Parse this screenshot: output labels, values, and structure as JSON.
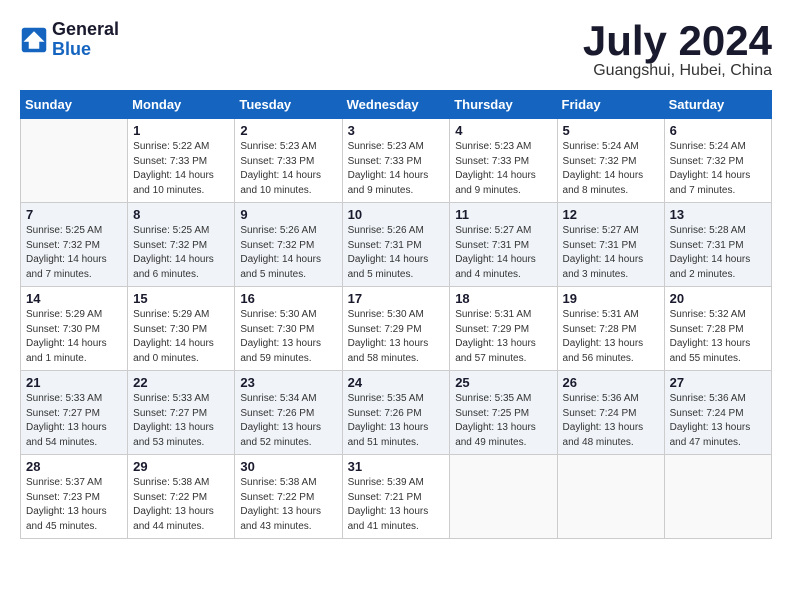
{
  "header": {
    "logo_general": "General",
    "logo_blue": "Blue",
    "month_title": "July 2024",
    "location": "Guangshui, Hubei, China"
  },
  "days_of_week": [
    "Sunday",
    "Monday",
    "Tuesday",
    "Wednesday",
    "Thursday",
    "Friday",
    "Saturday"
  ],
  "weeks": [
    [
      {
        "day": "",
        "info": ""
      },
      {
        "day": "1",
        "info": "Sunrise: 5:22 AM\nSunset: 7:33 PM\nDaylight: 14 hours\nand 10 minutes."
      },
      {
        "day": "2",
        "info": "Sunrise: 5:23 AM\nSunset: 7:33 PM\nDaylight: 14 hours\nand 10 minutes."
      },
      {
        "day": "3",
        "info": "Sunrise: 5:23 AM\nSunset: 7:33 PM\nDaylight: 14 hours\nand 9 minutes."
      },
      {
        "day": "4",
        "info": "Sunrise: 5:23 AM\nSunset: 7:33 PM\nDaylight: 14 hours\nand 9 minutes."
      },
      {
        "day": "5",
        "info": "Sunrise: 5:24 AM\nSunset: 7:32 PM\nDaylight: 14 hours\nand 8 minutes."
      },
      {
        "day": "6",
        "info": "Sunrise: 5:24 AM\nSunset: 7:32 PM\nDaylight: 14 hours\nand 7 minutes."
      }
    ],
    [
      {
        "day": "7",
        "info": "Sunrise: 5:25 AM\nSunset: 7:32 PM\nDaylight: 14 hours\nand 7 minutes."
      },
      {
        "day": "8",
        "info": "Sunrise: 5:25 AM\nSunset: 7:32 PM\nDaylight: 14 hours\nand 6 minutes."
      },
      {
        "day": "9",
        "info": "Sunrise: 5:26 AM\nSunset: 7:32 PM\nDaylight: 14 hours\nand 5 minutes."
      },
      {
        "day": "10",
        "info": "Sunrise: 5:26 AM\nSunset: 7:31 PM\nDaylight: 14 hours\nand 5 minutes."
      },
      {
        "day": "11",
        "info": "Sunrise: 5:27 AM\nSunset: 7:31 PM\nDaylight: 14 hours\nand 4 minutes."
      },
      {
        "day": "12",
        "info": "Sunrise: 5:27 AM\nSunset: 7:31 PM\nDaylight: 14 hours\nand 3 minutes."
      },
      {
        "day": "13",
        "info": "Sunrise: 5:28 AM\nSunset: 7:31 PM\nDaylight: 14 hours\nand 2 minutes."
      }
    ],
    [
      {
        "day": "14",
        "info": "Sunrise: 5:29 AM\nSunset: 7:30 PM\nDaylight: 14 hours\nand 1 minute."
      },
      {
        "day": "15",
        "info": "Sunrise: 5:29 AM\nSunset: 7:30 PM\nDaylight: 14 hours\nand 0 minutes."
      },
      {
        "day": "16",
        "info": "Sunrise: 5:30 AM\nSunset: 7:30 PM\nDaylight: 13 hours\nand 59 minutes."
      },
      {
        "day": "17",
        "info": "Sunrise: 5:30 AM\nSunset: 7:29 PM\nDaylight: 13 hours\nand 58 minutes."
      },
      {
        "day": "18",
        "info": "Sunrise: 5:31 AM\nSunset: 7:29 PM\nDaylight: 13 hours\nand 57 minutes."
      },
      {
        "day": "19",
        "info": "Sunrise: 5:31 AM\nSunset: 7:28 PM\nDaylight: 13 hours\nand 56 minutes."
      },
      {
        "day": "20",
        "info": "Sunrise: 5:32 AM\nSunset: 7:28 PM\nDaylight: 13 hours\nand 55 minutes."
      }
    ],
    [
      {
        "day": "21",
        "info": "Sunrise: 5:33 AM\nSunset: 7:27 PM\nDaylight: 13 hours\nand 54 minutes."
      },
      {
        "day": "22",
        "info": "Sunrise: 5:33 AM\nSunset: 7:27 PM\nDaylight: 13 hours\nand 53 minutes."
      },
      {
        "day": "23",
        "info": "Sunrise: 5:34 AM\nSunset: 7:26 PM\nDaylight: 13 hours\nand 52 minutes."
      },
      {
        "day": "24",
        "info": "Sunrise: 5:35 AM\nSunset: 7:26 PM\nDaylight: 13 hours\nand 51 minutes."
      },
      {
        "day": "25",
        "info": "Sunrise: 5:35 AM\nSunset: 7:25 PM\nDaylight: 13 hours\nand 49 minutes."
      },
      {
        "day": "26",
        "info": "Sunrise: 5:36 AM\nSunset: 7:24 PM\nDaylight: 13 hours\nand 48 minutes."
      },
      {
        "day": "27",
        "info": "Sunrise: 5:36 AM\nSunset: 7:24 PM\nDaylight: 13 hours\nand 47 minutes."
      }
    ],
    [
      {
        "day": "28",
        "info": "Sunrise: 5:37 AM\nSunset: 7:23 PM\nDaylight: 13 hours\nand 45 minutes."
      },
      {
        "day": "29",
        "info": "Sunrise: 5:38 AM\nSunset: 7:22 PM\nDaylight: 13 hours\nand 44 minutes."
      },
      {
        "day": "30",
        "info": "Sunrise: 5:38 AM\nSunset: 7:22 PM\nDaylight: 13 hours\nand 43 minutes."
      },
      {
        "day": "31",
        "info": "Sunrise: 5:39 AM\nSunset: 7:21 PM\nDaylight: 13 hours\nand 41 minutes."
      },
      {
        "day": "",
        "info": ""
      },
      {
        "day": "",
        "info": ""
      },
      {
        "day": "",
        "info": ""
      }
    ]
  ]
}
